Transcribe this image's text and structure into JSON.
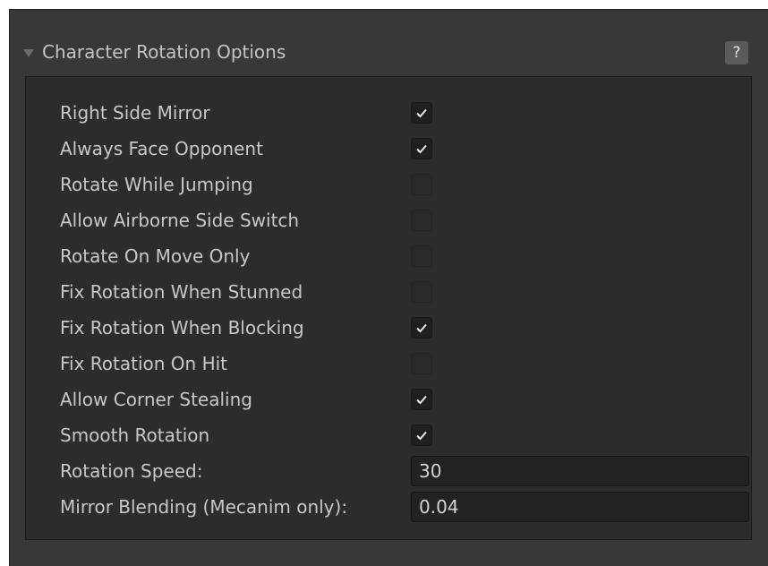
{
  "foldout": {
    "title": "Character Rotation Options",
    "help_label": "?"
  },
  "options": [
    {
      "label": "Right Side Mirror",
      "checked": true
    },
    {
      "label": "Always Face Opponent",
      "checked": true
    },
    {
      "label": "Rotate While Jumping",
      "checked": false
    },
    {
      "label": "Allow Airborne Side Switch",
      "checked": false
    },
    {
      "label": "Rotate On Move Only",
      "checked": false
    },
    {
      "label": "Fix Rotation When Stunned",
      "checked": false
    },
    {
      "label": "Fix Rotation When Blocking",
      "checked": true
    },
    {
      "label": "Fix Rotation On Hit",
      "checked": false
    },
    {
      "label": "Allow Corner Stealing",
      "checked": true
    },
    {
      "label": "Smooth Rotation",
      "checked": true
    }
  ],
  "fields": [
    {
      "label": "Rotation Speed:",
      "value": "30"
    },
    {
      "label": "Mirror Blending (Mecanim only):",
      "value": "0.04"
    }
  ],
  "icons": {
    "foldout": "triangle-down-icon",
    "check": "checkmark-icon"
  },
  "colors": {
    "panel_bg": "#383838",
    "content_bg": "#2c2c2c",
    "text": "#c8c8c8"
  }
}
